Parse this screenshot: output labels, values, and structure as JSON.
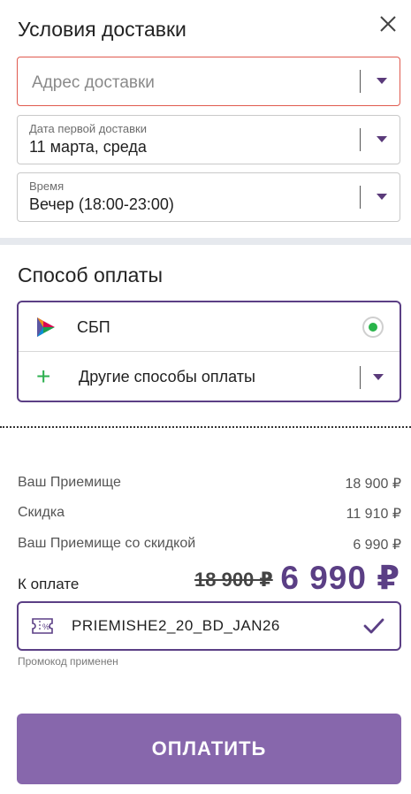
{
  "delivery": {
    "title": "Условия доставки",
    "address": {
      "placeholder": "Адрес доставки",
      "value": ""
    },
    "date": {
      "label": "Дата первой доставки",
      "value": "11 марта, среда"
    },
    "time": {
      "label": "Время",
      "value": "Вечер (18:00-23:00)"
    }
  },
  "payment": {
    "title": "Способ оплаты",
    "sbp": {
      "label": "СБП",
      "selected": true
    },
    "other": {
      "label": "Другие способы оплаты"
    }
  },
  "summary": {
    "rows": [
      {
        "label": "Ваш Приемище",
        "value": "18 900 ₽"
      },
      {
        "label": "Скидка",
        "value": "11 910 ₽"
      },
      {
        "label": "Ваш Приемище со скидкой",
        "value": "6 990 ₽"
      }
    ],
    "total_label": "К оплате",
    "old_price": "18 900 ₽",
    "new_price": "6 990 ₽"
  },
  "promo": {
    "code": "PRIEMISHE2_20_BD_JAN26",
    "note": "Промокод применен"
  },
  "pay_button": "ОПЛАТИТЬ",
  "colors": {
    "accent": "#5b3f85",
    "button": "#8767ac",
    "error_border": "#e05a4f",
    "success": "#29b44a"
  }
}
